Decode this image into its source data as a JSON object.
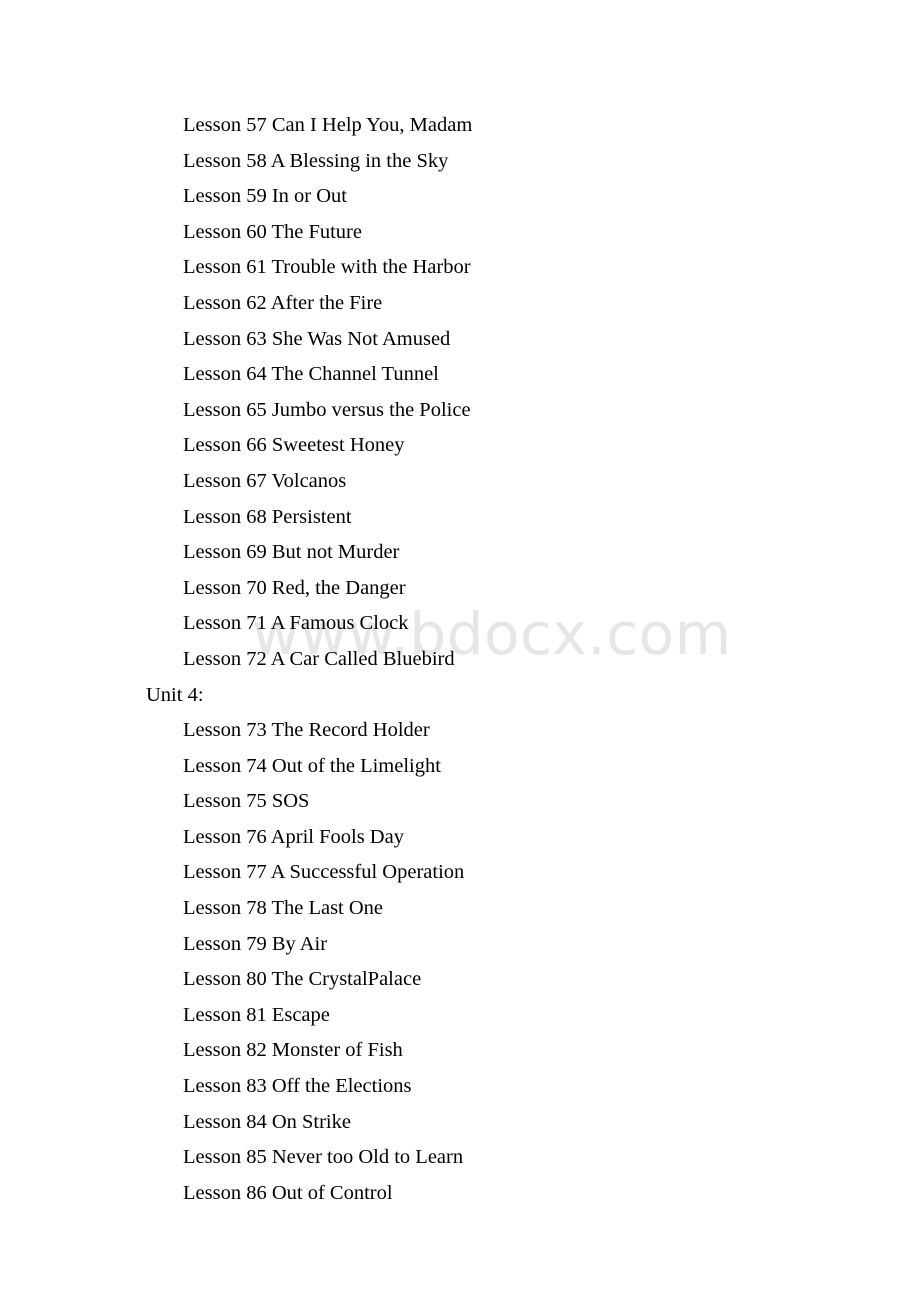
{
  "document": {
    "watermark": "www.bdocx.com",
    "watermark_color": "#e6e6e6",
    "text_color": "#000000",
    "background_color": "#ffffff",
    "lines": [
      {
        "text": "Lesson 57 Can I Help You, Madam",
        "indent": "lesson"
      },
      {
        "text": "Lesson 58 A Blessing in the Sky",
        "indent": "lesson"
      },
      {
        "text": "Lesson 59 In or Out",
        "indent": "lesson"
      },
      {
        "text": "Lesson 60 The Future",
        "indent": "lesson"
      },
      {
        "text": "Lesson 61 Trouble with the Harbor",
        "indent": "lesson"
      },
      {
        "text": "Lesson 62 After the Fire",
        "indent": "lesson"
      },
      {
        "text": "Lesson 63 She Was Not Amused",
        "indent": "lesson"
      },
      {
        "text": "Lesson 64 The Channel Tunnel",
        "indent": "lesson"
      },
      {
        "text": "Lesson 65 Jumbo versus the Police",
        "indent": "lesson"
      },
      {
        "text": "Lesson 66 Sweetest Honey",
        "indent": "lesson"
      },
      {
        "text": "Lesson 67 Volcanos",
        "indent": "lesson"
      },
      {
        "text": "Lesson 68 Persistent",
        "indent": "lesson"
      },
      {
        "text": "Lesson 69 But not Murder",
        "indent": "lesson"
      },
      {
        "text": "Lesson 70 Red, the Danger",
        "indent": "lesson"
      },
      {
        "text": "Lesson 71 A Famous Clock",
        "indent": "lesson"
      },
      {
        "text": "Lesson 72 A Car Called Bluebird",
        "indent": "lesson"
      },
      {
        "text": "Unit 4:",
        "indent": "unit"
      },
      {
        "text": "Lesson 73 The Record Holder",
        "indent": "lesson"
      },
      {
        "text": "Lesson 74 Out of the Limelight",
        "indent": "lesson"
      },
      {
        "text": "Lesson 75 SOS",
        "indent": "lesson"
      },
      {
        "text": "Lesson 76 April Fools Day",
        "indent": "lesson"
      },
      {
        "text": "Lesson 77 A Successful Operation",
        "indent": "lesson"
      },
      {
        "text": "Lesson 78 The Last One",
        "indent": "lesson"
      },
      {
        "text": "Lesson 79 By Air",
        "indent": "lesson"
      },
      {
        "text": "Lesson 80 The CrystalPalace",
        "indent": "lesson"
      },
      {
        "text": "Lesson 81 Escape",
        "indent": "lesson"
      },
      {
        "text": "Lesson 82 Monster of Fish",
        "indent": "lesson"
      },
      {
        "text": "Lesson 83 Off the Elections",
        "indent": "lesson"
      },
      {
        "text": "Lesson 84 On Strike",
        "indent": "lesson"
      },
      {
        "text": "Lesson 85 Never too Old to Learn",
        "indent": "lesson"
      },
      {
        "text": "Lesson 86 Out of Control",
        "indent": "lesson"
      }
    ]
  }
}
